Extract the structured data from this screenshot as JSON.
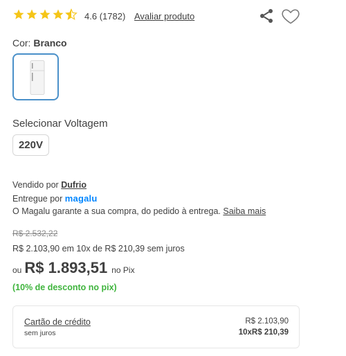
{
  "rating": {
    "stars": 4.6,
    "value": "4.6",
    "count": "(1782)",
    "review_link": "Avaliar produto",
    "star_color": "#f5c518"
  },
  "actions": {
    "share_icon": "share-icon",
    "favorite_icon": "heart-icon"
  },
  "color": {
    "label": "Cor:",
    "selected": "Branco",
    "selected_border": "#4a90c9"
  },
  "voltage": {
    "label": "Selecionar Voltagem",
    "option": "220V"
  },
  "seller": {
    "sold_by_prefix": "Vendido por",
    "sold_by": "Dufrio",
    "delivered_by_prefix": "Entregue por",
    "delivered_by": "magalu",
    "guarantee_text": "O Magalu garante a sua compra, do pedido à entrega.",
    "guarantee_link": "Saiba mais",
    "brand_color": "#0086ff"
  },
  "price": {
    "old": "R$ 2.532,22",
    "installments": "R$ 2.103,90 em 10x de R$ 210,39 sem juros",
    "pix_prefix": "ou",
    "pix_value": "R$ 1.893,51",
    "pix_suffix": "no Pix",
    "discount": "(10% de desconto no pix)",
    "discount_color": "#3fb43d"
  },
  "payment": {
    "title": "Cartão de crédito",
    "subtitle": "sem juros",
    "total": "R$ 2.103,90",
    "installments": "10xR$ 210,39"
  }
}
